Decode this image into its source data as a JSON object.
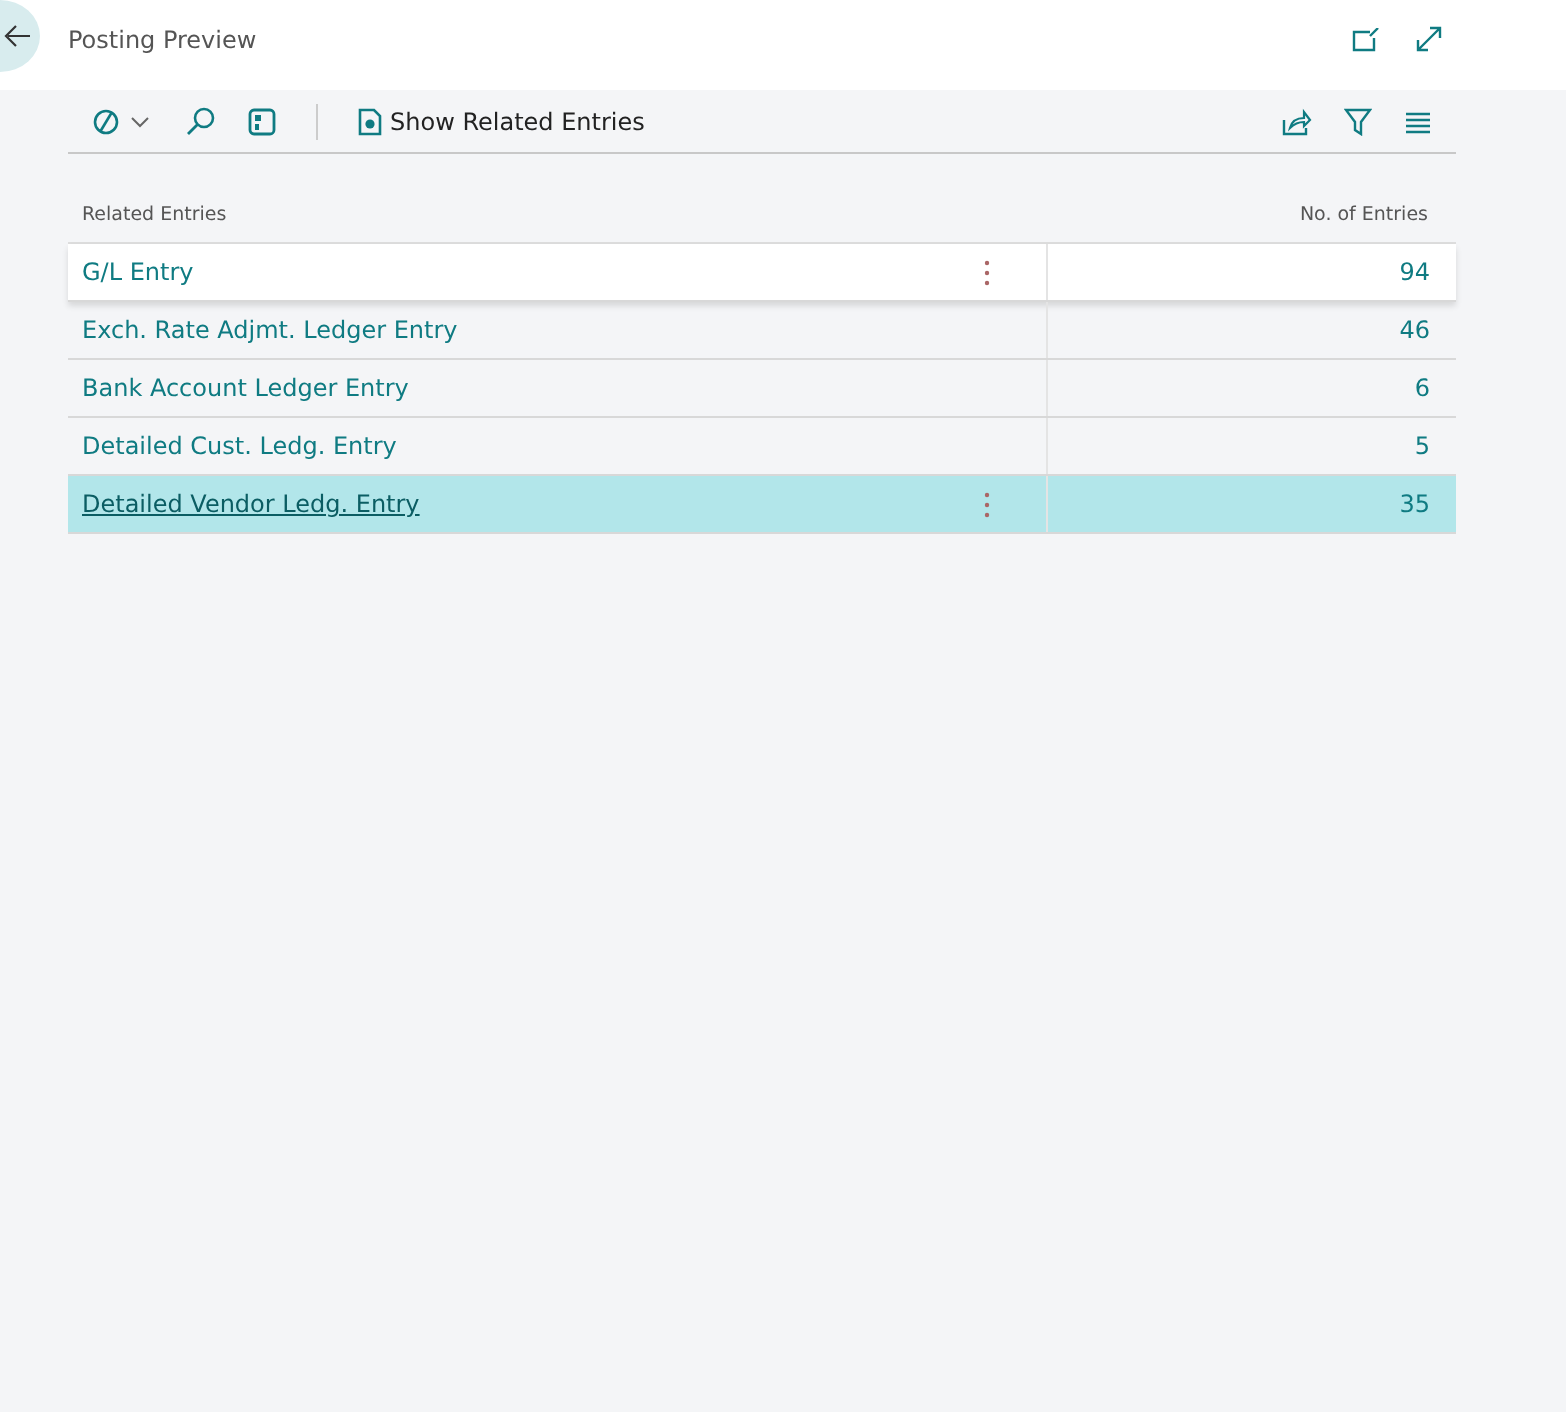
{
  "window": {
    "title": "Posting Preview"
  },
  "toolbar": {
    "actions": [
      {
        "kind": "power"
      },
      {
        "kind": "search"
      },
      {
        "kind": "layout"
      },
      {
        "kind": "related",
        "label": "Show Related Entries"
      }
    ]
  },
  "table": {
    "columns": [
      "Related Entries",
      "No. of Entries"
    ],
    "rows": [
      {
        "name": "G/L Entry",
        "count": "94",
        "selected": false,
        "highlighted": true
      },
      {
        "name": "Exch. Rate Adjmt. Ledger Entry",
        "count": "46",
        "selected": false,
        "highlighted": false
      },
      {
        "name": "Bank Account Ledger Entry",
        "count": "6",
        "selected": false,
        "highlighted": false
      },
      {
        "name": "Detailed Cust. Ledg. Entry",
        "count": "5",
        "selected": false,
        "highlighted": false
      },
      {
        "name": "Detailed Vendor Ledg. Entry",
        "count": "35",
        "selected": true,
        "highlighted": false
      }
    ]
  }
}
